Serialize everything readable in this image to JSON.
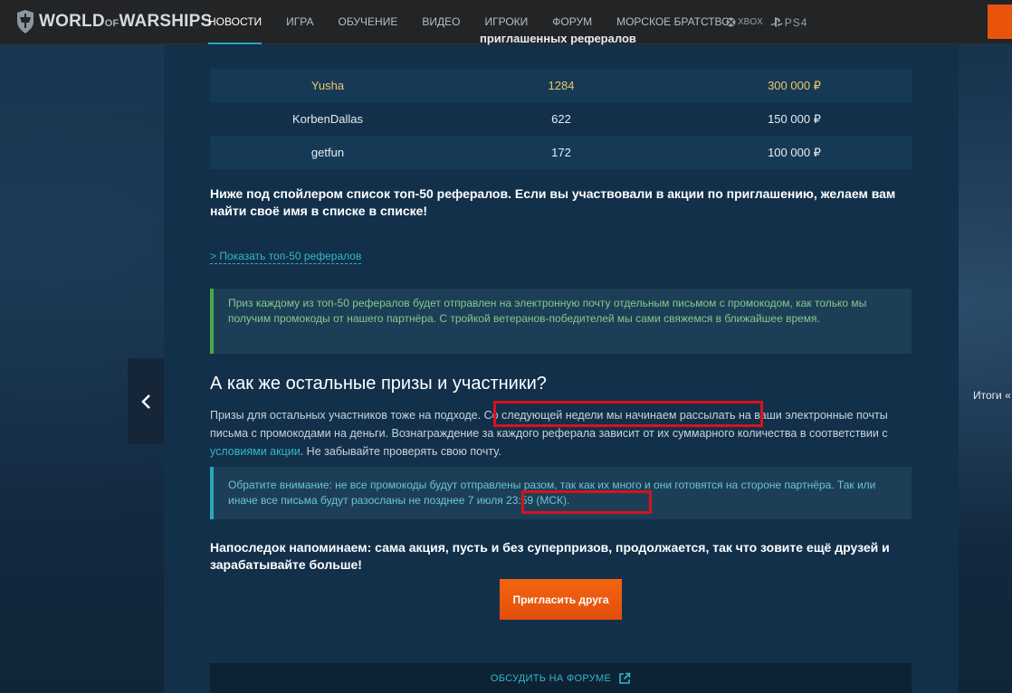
{
  "header": {
    "logo_text": "WORLD",
    "logo_of": "OF",
    "logo_text2": "WARSHIPS",
    "nav": [
      {
        "label": "НОВОСТИ",
        "active": true
      },
      {
        "label": "ИГРА",
        "active": false
      },
      {
        "label": "ОБУЧЕНИЕ",
        "active": false
      },
      {
        "label": "ВИДЕО",
        "active": false
      },
      {
        "label": "ИГРОКИ",
        "active": false
      },
      {
        "label": "ФОРУМ",
        "active": false
      },
      {
        "label": "МОРСКОЕ БРАТСТВО",
        "active": false
      }
    ],
    "platforms": [
      {
        "label": "XBOX",
        "icon": "xbox-icon"
      },
      {
        "label": "PS4",
        "icon": "playstation-icon"
      }
    ]
  },
  "side": {
    "next_label": "Итоги «"
  },
  "table": {
    "heading": "приглашенных рефералов",
    "rows": [
      {
        "name": "Yusha",
        "count": "1284",
        "prize": "300 000 ₽",
        "highlight": true
      },
      {
        "name": "KorbenDallas",
        "count": "622",
        "prize": "150 000 ₽",
        "highlight": false
      },
      {
        "name": "getfun",
        "count": "172",
        "prize": "100 000 ₽",
        "highlight": false
      }
    ]
  },
  "article": {
    "para_top50": "Ниже под спойлером список топ-50 рефералов. Если вы участвовали в акции по приглашению, желаем вам найти своё имя в списке в списке!",
    "spoiler_label": "> Показать топ-50 рефералов",
    "note_green": "Приз каждому из топ-50 рефералов будет отправлен на электронную почту отдельным письмом с промокодом, как только мы получим промокоды от нашего партнёра. С тройкой ветеранов-победителей мы сами свяжемся в ближайшее время.",
    "heading": "А как же остальные призы и участники?",
    "para_rest_1": "Призы для остальных участников тоже на подходе.",
    "para_rest_2": " Со следующей недели мы начинаем рассылать",
    "para_rest_3": " на ваши электронные почты письма с промокодами на деньги. Вознаграждение за каждого реферала зависит от их суммарного количества в соответствии с ",
    "para_rest_link": "условиями акции",
    "para_rest_4": ". Не забывайте проверять свою почту.",
    "note_teal_1": "Обратите внимание: не все промокоды будут отправлены разом, так как их много и они готовятся на стороне партнёра. Так или иначе все письма будут разосланы не позднее ",
    "note_teal_date": "7 июля 23:59 (МСК).",
    "para_final": "Напоследок напоминаем: сама акция, пусть и без суперпризов, продолжается, так что зовите ещё друзей и зарабатывайте больше!",
    "invite_button": "Пригласить друга",
    "forum_link": "ОБСУДИТЬ НА ФОРУМЕ"
  },
  "colors": {
    "accent_teal": "#2ba7ba",
    "cta_orange": "#e9540d",
    "highlight_red": "#d8121b",
    "gold": "#f2c46b"
  }
}
